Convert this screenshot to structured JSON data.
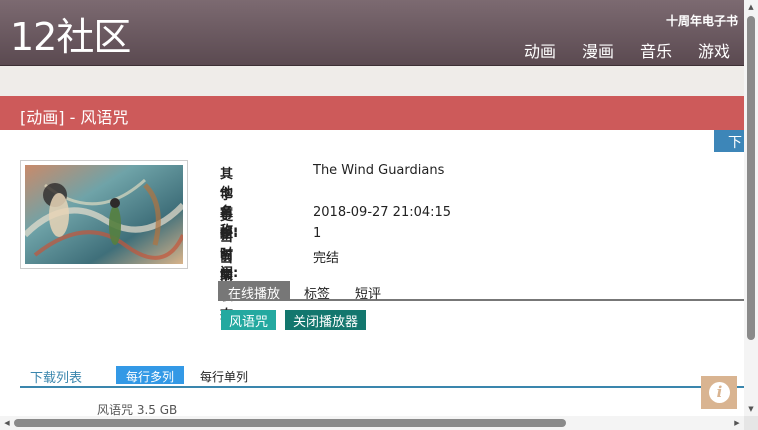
{
  "header": {
    "logo": "12社区",
    "subtitle": "十周年电子书",
    "nav": [
      {
        "label": "动画"
      },
      {
        "label": "漫画"
      },
      {
        "label": "音乐"
      },
      {
        "label": "游戏"
      }
    ]
  },
  "title_bar": {
    "text": "[动画] - 风语咒"
  },
  "side_tab": {
    "label": "下"
  },
  "info": {
    "rows": [
      {
        "label": "其他名称:",
        "value": "The Wind Guardians"
      },
      {
        "label": "字幕组:",
        "value": ""
      },
      {
        "label": "更新时间:",
        "value": "2018-09-27 21:04:15"
      },
      {
        "label": "当前集数:",
        "value": "1"
      },
      {
        "label": "当前状态:",
        "value": "完结"
      }
    ]
  },
  "tabs": [
    {
      "label": "在线播放",
      "active": true
    },
    {
      "label": "标签"
    },
    {
      "label": "短评"
    }
  ],
  "buttons": {
    "play": "风语咒",
    "close_player": "关闭播放器"
  },
  "download": {
    "title": "下载列表",
    "view_multi": "每行多列",
    "view_single": "每行单列",
    "files": [
      {
        "name": "风语咒",
        "size": "3.5 GB"
      }
    ]
  },
  "info_button": {
    "icon": "info-icon",
    "glyph": "i"
  },
  "colors": {
    "header": "#6b5a61",
    "title_bar": "#cd5a5a",
    "accent_blue": "#3a86ad",
    "teal": "#24a9a0",
    "dark_teal": "#13776e"
  }
}
